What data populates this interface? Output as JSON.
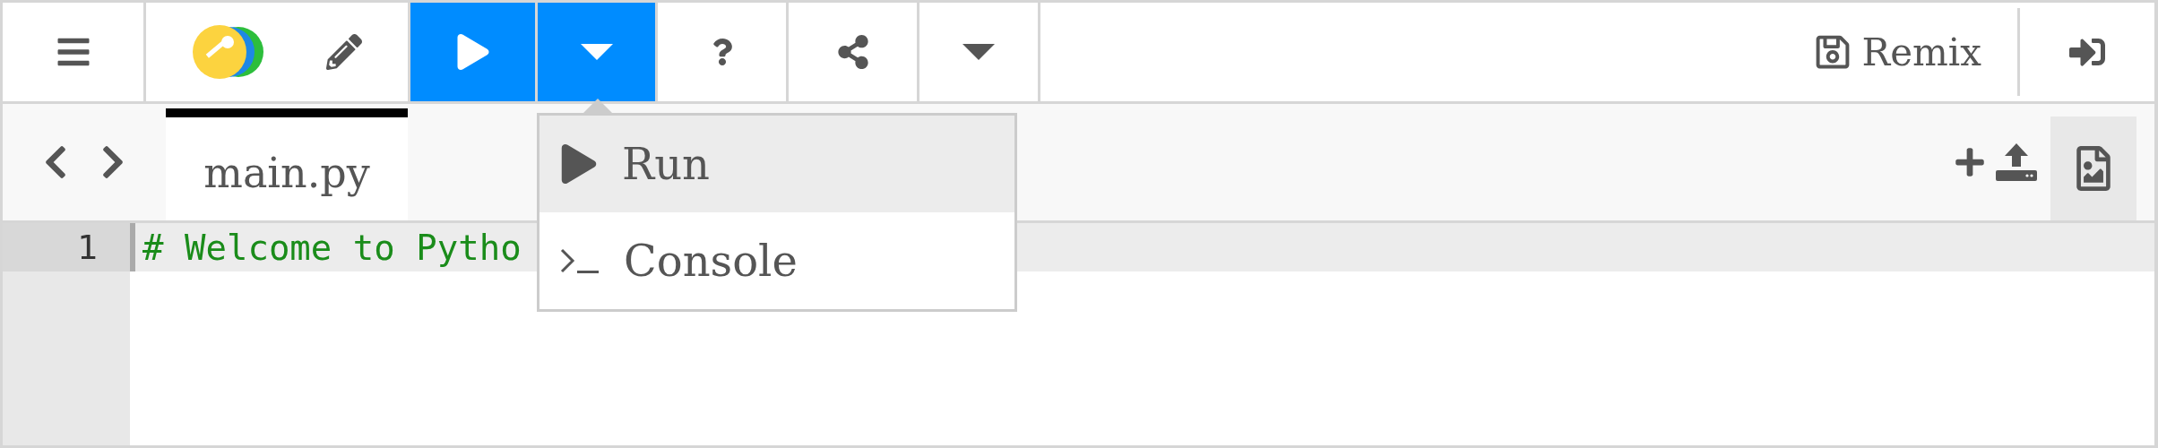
{
  "toolbar": {
    "run_button": {
      "active": true
    },
    "run_menu_button": {
      "expanded": true
    },
    "remix_button": {
      "label": "Remix"
    }
  },
  "run_menu": {
    "items": [
      {
        "kind": "run",
        "label": "Run",
        "selected": true
      },
      {
        "kind": "console",
        "label": "Console",
        "selected": false
      }
    ]
  },
  "file_tabs": [
    {
      "label": "main.py",
      "selected": true
    }
  ],
  "editor": {
    "lines": [
      {
        "number": "1",
        "text": "# Welcome to Pytho",
        "current": true
      }
    ]
  }
}
